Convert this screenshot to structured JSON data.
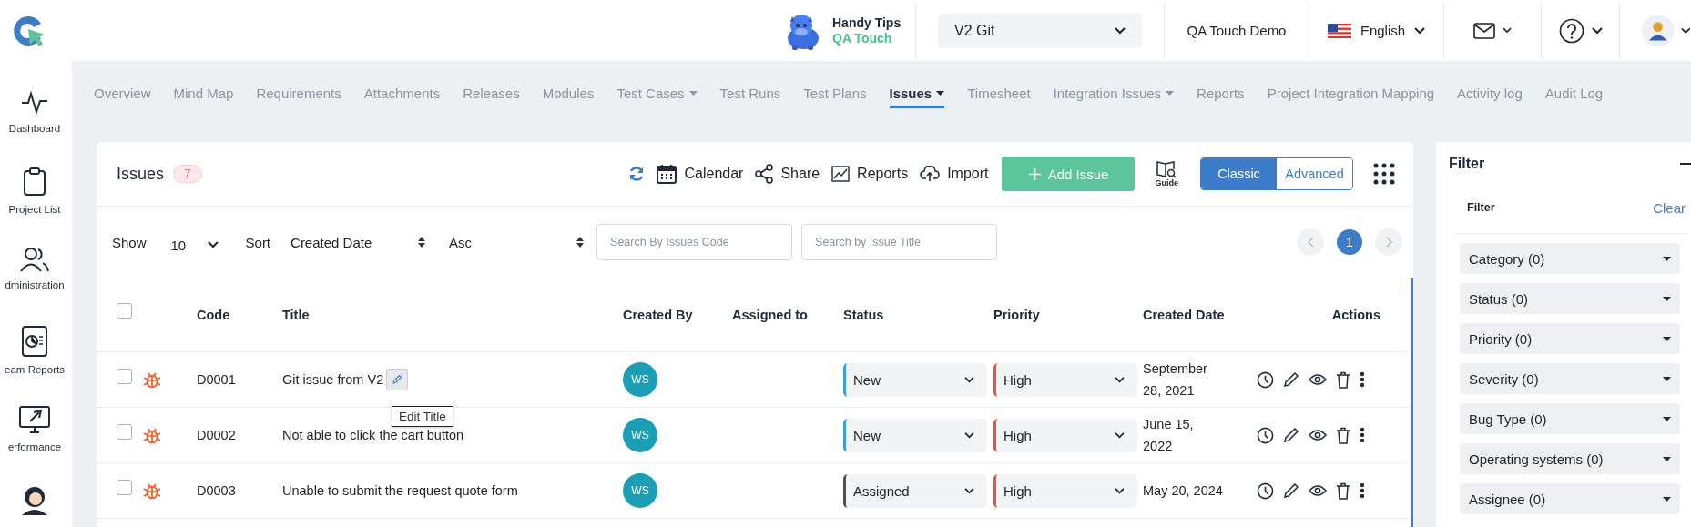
{
  "header": {
    "tip_title": "Handy Tips",
    "tip_subtitle": "QA Touch",
    "project": "V2 Git",
    "workspace": "QA Touch Demo",
    "language": "English"
  },
  "sidebar": {
    "items": [
      {
        "kind": "pulse",
        "label": "Dashboard"
      },
      {
        "kind": "clipboard",
        "label": "Project List"
      },
      {
        "kind": "users",
        "label": "dministration"
      },
      {
        "kind": "report",
        "label": "eam Reports"
      },
      {
        "kind": "rocket",
        "label": "erformance"
      },
      {
        "kind": "support"
      }
    ]
  },
  "nav": {
    "tabs": [
      {
        "label": "Overview",
        "selected": false,
        "dropdown": false
      },
      {
        "label": "Mind Map",
        "selected": false,
        "dropdown": false
      },
      {
        "label": "Requirements",
        "selected": false,
        "dropdown": false
      },
      {
        "label": "Attachments",
        "selected": false,
        "dropdown": false
      },
      {
        "label": "Releases",
        "selected": false,
        "dropdown": false
      },
      {
        "label": "Modules",
        "selected": false,
        "dropdown": false
      },
      {
        "label": "Test Cases",
        "selected": false,
        "dropdown": true
      },
      {
        "label": "Test Runs",
        "selected": false,
        "dropdown": false
      },
      {
        "label": "Test Plans",
        "selected": false,
        "dropdown": false
      },
      {
        "label": "Issues",
        "selected": true,
        "dropdown": true
      },
      {
        "label": "Timesheet",
        "selected": false,
        "dropdown": false
      },
      {
        "label": "Integration Issues",
        "selected": false,
        "dropdown": true
      },
      {
        "label": "Reports",
        "selected": false,
        "dropdown": false
      },
      {
        "label": "Project Integration Mapping",
        "selected": false,
        "dropdown": false
      },
      {
        "label": "Activity log",
        "selected": false,
        "dropdown": false
      },
      {
        "label": "Audit Log",
        "selected": false,
        "dropdown": false
      }
    ]
  },
  "issues": {
    "title": "Issues",
    "count": "7",
    "toolbar": [
      {
        "kind": "refresh"
      },
      {
        "kind": "calendar",
        "label": "Calendar"
      },
      {
        "kind": "share",
        "label": "Share"
      },
      {
        "kind": "reports",
        "label": "Reports"
      },
      {
        "kind": "import",
        "label": "Import"
      }
    ],
    "add_button": "Add Issue",
    "guide": "Guide",
    "views": [
      {
        "label": "Classic",
        "selected": true
      },
      {
        "label": "Advanced",
        "selected": false
      }
    ]
  },
  "controls": {
    "show_label": "Show",
    "page_size": "10",
    "sort_label": "Sort",
    "sort_field": "Created Date",
    "sort_order": "Asc",
    "search_code": {
      "placeholder": "Search By Issues Code"
    },
    "search_title": {
      "placeholder": "Search by Issue Title"
    },
    "page": "1"
  },
  "table": {
    "all_checked": false,
    "columns": [
      "Code",
      "Title",
      "Created By",
      "Assigned to",
      "Status",
      "Priority",
      "Created Date",
      "Actions"
    ],
    "edit_tooltip": "Edit Title",
    "rows": [
      {
        "checked": false,
        "hovered": true,
        "code": "D0001",
        "title": "Git issue from V2",
        "created_by": "WS",
        "status": {
          "label": "New",
          "color": "#3d9be0"
        },
        "priority": {
          "label": "High",
          "color": "#e4573b"
        },
        "created_date": "September 28, 2021"
      },
      {
        "checked": false,
        "hovered": false,
        "code": "D0002",
        "title": "Not able to click the cart button",
        "created_by": "WS",
        "status": {
          "label": "New",
          "color": "#3d9be0"
        },
        "priority": {
          "label": "High",
          "color": "#e4573b"
        },
        "created_date": "June 15, 2022"
      },
      {
        "checked": false,
        "hovered": false,
        "code": "D0003",
        "title": "Unable to submit the request quote form",
        "created_by": "WS",
        "status": {
          "label": "Assigned",
          "color": "#4a4f5a"
        },
        "priority": {
          "label": "High",
          "color": "#e4573b"
        },
        "created_date": "May 20, 2024"
      }
    ]
  },
  "filter": {
    "title": "Filter",
    "label": "Filter",
    "clear": "Clear",
    "dropdowns": [
      "Category (0)",
      "Status (0)",
      "Priority (0)",
      "Severity (0)",
      "Bug Type (0)",
      "Operating systems (0)",
      "Assignee (0)"
    ]
  }
}
